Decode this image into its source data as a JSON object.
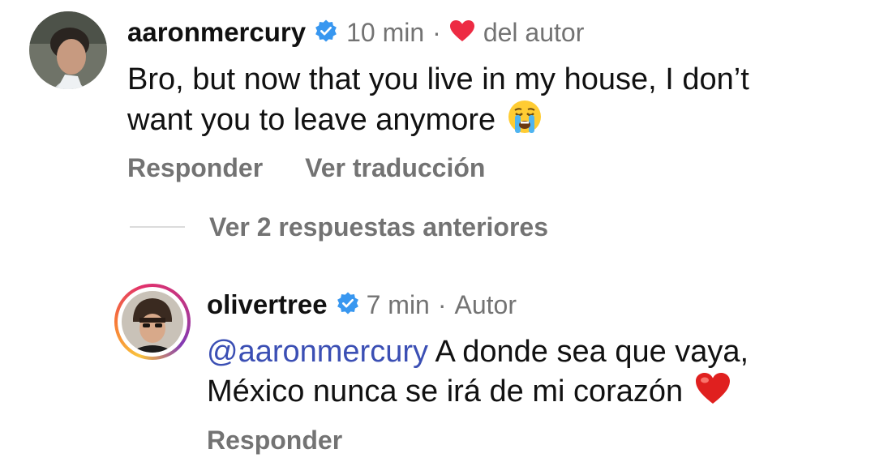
{
  "comment": {
    "username": "aaronmercury",
    "time": "10 min",
    "separator": "·",
    "liked_by_author_label": "del autor",
    "text": "Bro, but now that you live in my house, I don’t want you to leave anymore",
    "text_line1": "Bro, but now that you live in my house, I don’t",
    "text_line2": "want you to leave anymore",
    "emoji": "crying-face",
    "actions": {
      "reply": "Responder",
      "translate": "Ver traducción"
    }
  },
  "replies_toggle": {
    "label": "Ver 2 respuestas anteriores"
  },
  "reply": {
    "username": "olivertree",
    "time": "7 min",
    "separator": "·",
    "author_badge": "Autor",
    "mention": "@aaronmercury",
    "text_line1_rest": " A donde sea que vaya,",
    "text_line2": "México nunca se irá de mi corazón",
    "emoji": "red-heart",
    "actions": {
      "reply": "Responder"
    }
  },
  "colors": {
    "meta_gray": "#737373",
    "mention_blue": "#3b4fb4",
    "verified_blue": "#3897f0",
    "heart_red": "#ed2b43",
    "divider": "#dbdbdb"
  }
}
